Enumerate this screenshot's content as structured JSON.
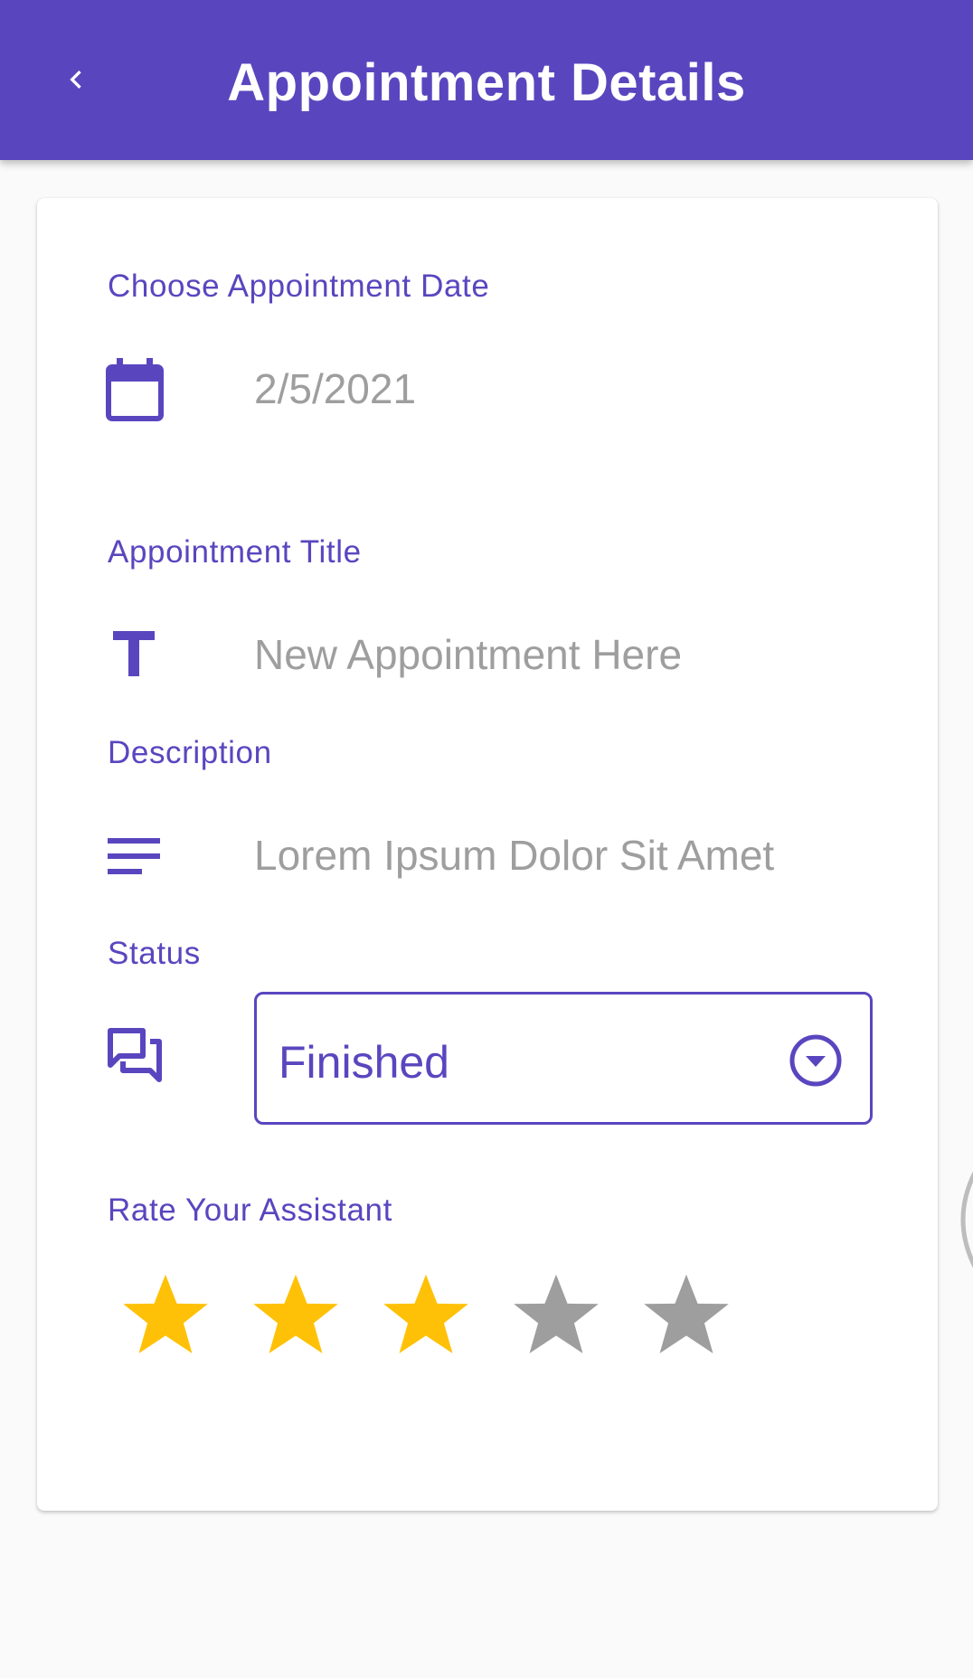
{
  "appbar": {
    "title": "Appointment Details",
    "back_icon": "chevron-left-icon",
    "background": "#5946bf"
  },
  "form": {
    "date": {
      "label": "Choose Appointment Date",
      "icon": "calendar-icon",
      "value": "2/5/2021"
    },
    "title": {
      "label": "Appointment Title",
      "icon": "text-t-icon",
      "placeholder": "New Appointment Here"
    },
    "description": {
      "label": "Description",
      "icon": "notes-lines-icon",
      "placeholder": "Lorem Ipsum Dolor Sit Amet"
    },
    "status": {
      "label": "Status",
      "icon": "chat-bubbles-icon",
      "selected": "Finished",
      "dropdown_icon": "chevron-down-circle-icon"
    },
    "rating": {
      "label": "Rate Your Assistant",
      "value": 3,
      "max": 5,
      "filled_color": "#ffc107",
      "empty_color": "#9e9e9e"
    }
  },
  "colors": {
    "accent": "#5946bf",
    "muted_text": "#9e9e9e",
    "card": "#ffffff",
    "page": "#fafafa"
  }
}
